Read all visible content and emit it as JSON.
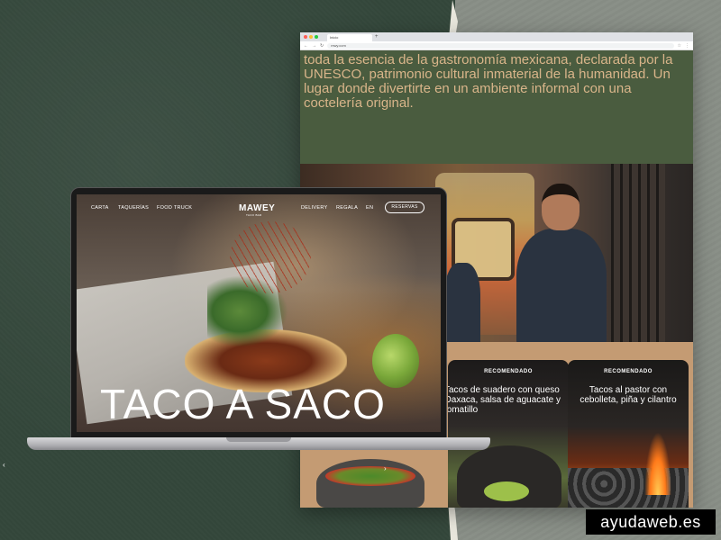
{
  "browser": {
    "tab_title": "Inicio",
    "url": "mwy.com",
    "intro_text": "toda la esencia de la gastronomía mexicana, declarada por la UNESCO, patrimonio cultural inmaterial de la humanidad. Un lugar donde divertirte en un ambiente informal con una coctelería original.",
    "cards": [
      {
        "tag": "RECOMENDADO",
        "text": "Tacos de suadero con queso Oaxaca, salsa de aguacate y tomatillo"
      },
      {
        "tag": "RECOMENDADO",
        "text": "Tacos al pastor con cebolleta, piña y cilantro"
      }
    ]
  },
  "laptop": {
    "nav": {
      "carta": "CARTA",
      "taquerias": "TAQUERÍAS",
      "food_truck": "FOOD TRUCK",
      "logo": "MAWEY",
      "logo_sub": "TACO BAR",
      "delivery": "DELIVERY",
      "regala": "REGALA",
      "lang": "EN",
      "reservas": "RESERVAS"
    },
    "hero_title": "TACO A SACO"
  },
  "watermark": "ayudaweb.es",
  "colors": {
    "intro_bg": "#4a5c3f",
    "intro_text": "#d9b58a",
    "cards_bg": "#c49b73",
    "left_bg": "#33463a"
  }
}
